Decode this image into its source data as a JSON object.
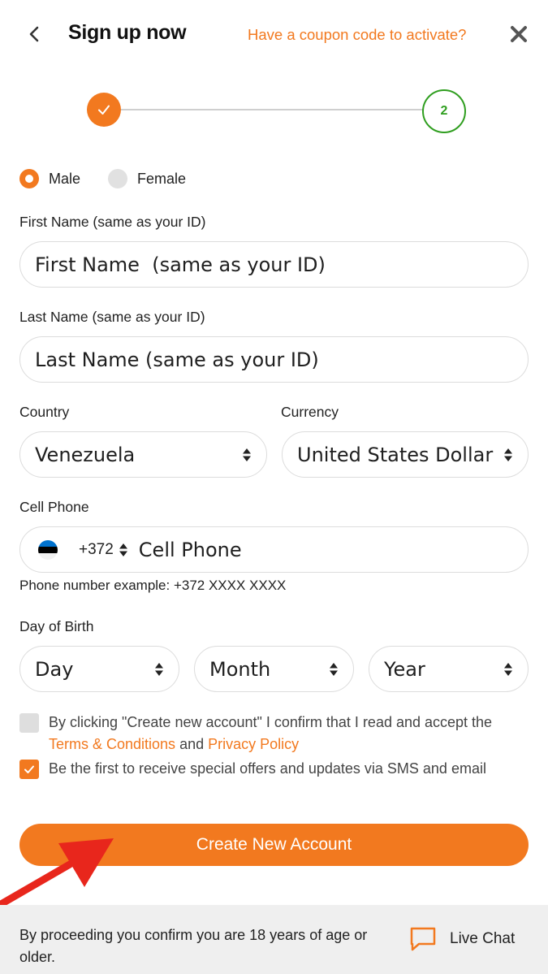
{
  "header": {
    "title": "Sign up now",
    "coupon_link": "Have a coupon code to activate?"
  },
  "stepper": {
    "steps": [
      {
        "state": "completed",
        "label": ""
      },
      {
        "state": "current",
        "label": "2"
      }
    ]
  },
  "form": {
    "gender": {
      "options": [
        {
          "label": "Male",
          "selected": true
        },
        {
          "label": "Female",
          "selected": false
        }
      ]
    },
    "first_name": {
      "label": "First Name (same as your ID)",
      "placeholder": "First Name  (same as your ID)"
    },
    "last_name": {
      "label": "Last Name (same as your ID)",
      "placeholder": "Last Name (same as your ID)"
    },
    "country": {
      "label": "Country",
      "value": "Venezuela"
    },
    "currency": {
      "label": "Currency",
      "value": "United States Dollar"
    },
    "phone": {
      "label": "Cell Phone",
      "code": "+372",
      "placeholder": "Cell Phone",
      "hint": "Phone number example: +372 XXXX XXXX"
    },
    "birth": {
      "label": "Day of Birth",
      "day": "Day",
      "month": "Month",
      "year": "Year"
    },
    "terms": {
      "checked": false,
      "text_before": "By clicking \"Create new account\" I confirm that I read and accept the ",
      "terms_link": "Terms & Conditions",
      "and": " and ",
      "privacy_link": "Privacy Policy"
    },
    "offers": {
      "checked": true,
      "text": "Be the first to receive special offers and updates via SMS and email"
    },
    "submit_label": "Create New Account"
  },
  "footer": {
    "age_notice": "By proceeding you confirm you are 18 years of age or older.",
    "live_chat": "Live Chat"
  },
  "colors": {
    "accent": "#f2791f",
    "step_current": "#2f9e1f",
    "annotation_arrow": "#e8261c"
  }
}
